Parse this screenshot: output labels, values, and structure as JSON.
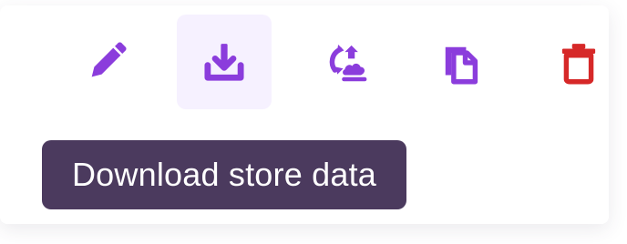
{
  "toolbar": {
    "buttons": [
      {
        "name": "edit",
        "icon": "pencil-icon",
        "color": "#8b3ddc"
      },
      {
        "name": "download-store-data",
        "icon": "download-icon",
        "color": "#8b3ddc",
        "active": true
      },
      {
        "name": "restore",
        "icon": "restore-icon",
        "color": "#8b3ddc"
      },
      {
        "name": "copy",
        "icon": "copy-icon",
        "color": "#8b3ddc"
      },
      {
        "name": "delete",
        "icon": "trash-icon",
        "color": "#d62828"
      }
    ]
  },
  "tooltip": {
    "text": "Download store data",
    "background": "#4b3a5e",
    "text_color": "#ffffff"
  }
}
